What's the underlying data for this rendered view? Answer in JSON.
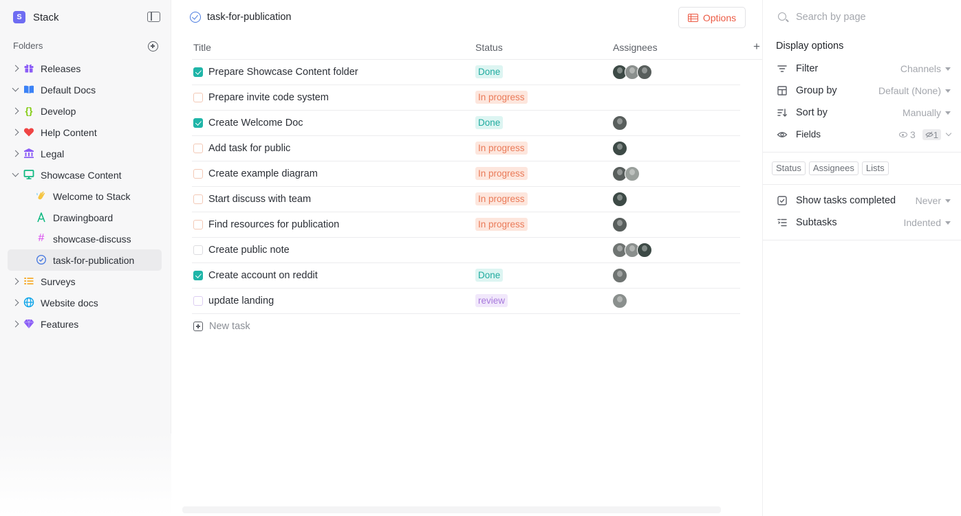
{
  "workspace": {
    "initial": "S",
    "name": "Stack"
  },
  "sidebar": {
    "folders_label": "Folders",
    "items": [
      {
        "label": "Releases",
        "icon": "gift-icon",
        "color": "#8b5cf6"
      },
      {
        "label": "Default Docs",
        "icon": "book-icon",
        "color": "#3b82f6"
      },
      {
        "label": "Develop",
        "icon": "curly-braces-icon",
        "color": "#84cc16"
      },
      {
        "label": "Help Content",
        "icon": "heart-icon",
        "color": "#ef4444"
      },
      {
        "label": "Legal",
        "icon": "bank-icon",
        "color": "#8b5cf6"
      },
      {
        "label": "Showcase Content",
        "icon": "monitor-icon",
        "color": "#10b981"
      },
      {
        "label": "Welcome to Stack",
        "icon": "wave-hand-icon",
        "color": "#f5c542"
      },
      {
        "label": "Drawingboard",
        "icon": "drawing-icon",
        "color": "#10b981"
      },
      {
        "label": "showcase-discuss",
        "icon": "hash-icon",
        "color": "#d946ef"
      },
      {
        "label": "task-for-publication",
        "icon": "check-circle-icon",
        "color": "#4a7be0"
      },
      {
        "label": "Surveys",
        "icon": "list-icon",
        "color": "#f59e0b"
      },
      {
        "label": "Website docs",
        "icon": "globe-icon",
        "color": "#0ea5e9"
      },
      {
        "label": "Features",
        "icon": "diamond-icon",
        "color": "#8b5cf6"
      }
    ]
  },
  "main": {
    "title": "task-for-publication",
    "options_label": "Options",
    "columns": {
      "title": "Title",
      "status": "Status",
      "assignees": "Assignees"
    },
    "add_column": "+",
    "tasks": [
      {
        "title": "Prepare Showcase Content folder",
        "status": "Done",
        "completed": true,
        "assignees": 3
      },
      {
        "title": "Prepare invite code system",
        "status": "In progress",
        "completed": false,
        "assignees": 0
      },
      {
        "title": "Create Welcome Doc",
        "status": "Done",
        "completed": true,
        "assignees": 1
      },
      {
        "title": "Add task for public",
        "status": "In progress",
        "completed": false,
        "assignees": 1
      },
      {
        "title": "Create example diagram",
        "status": "In progress",
        "completed": false,
        "assignees": 2
      },
      {
        "title": "Start discuss with team",
        "status": "In progress",
        "completed": false,
        "assignees": 1
      },
      {
        "title": "Find resources for publication",
        "status": "In progress",
        "completed": false,
        "assignees": 1
      },
      {
        "title": "Create public note",
        "status": "",
        "completed": false,
        "assignees": 3
      },
      {
        "title": "Create account on reddit",
        "status": "Done",
        "completed": true,
        "assignees": 1
      },
      {
        "title": "update landing",
        "status": "review",
        "completed": false,
        "assignees": 1
      }
    ],
    "new_task_label": "New task"
  },
  "panel": {
    "search_placeholder": "Search by page",
    "display_options": "Display options",
    "filter": {
      "label": "Filter",
      "value": "Channels"
    },
    "group_by": {
      "label": "Group by",
      "value": "Default (None)"
    },
    "sort_by": {
      "label": "Sort by",
      "value": "Manually"
    },
    "fields": {
      "label": "Fields",
      "visible": "3",
      "hidden": "1"
    },
    "chips": [
      "Status",
      "Assignees",
      "Lists"
    ],
    "show_completed": {
      "label": "Show tasks completed",
      "value": "Never"
    },
    "subtasks": {
      "label": "Subtasks",
      "value": "Indented"
    }
  },
  "colors": {
    "accent": "#ec5b45",
    "done": "#1fb5a8",
    "progress": "#ea7a58",
    "review": "#a779dc"
  }
}
